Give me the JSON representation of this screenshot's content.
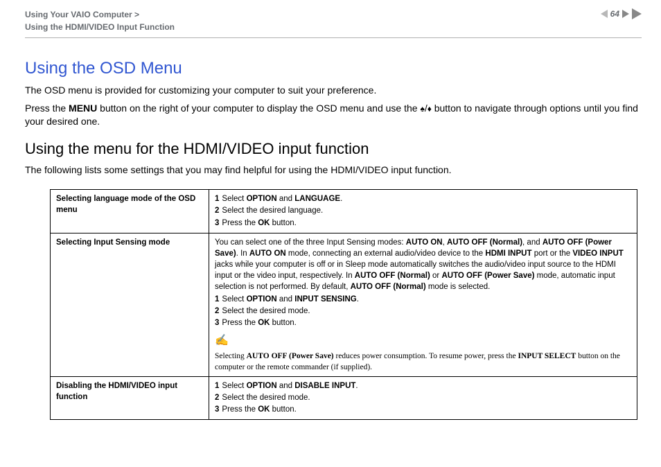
{
  "header": {
    "breadcrumb_line1": "Using Your VAIO Computer >",
    "breadcrumb_line2": "Using the HDMI/VIDEO Input Function",
    "page_number": "64"
  },
  "h1": "Using the OSD Menu",
  "p1_a": "The OSD menu is provided for customizing your computer to suit your preference.",
  "p2_pre": "Press the ",
  "p2_b1": "MENU",
  "p2_mid": " button on the right of your computer to display the OSD menu and use the ",
  "p2_post": " button to navigate through options until you find your desired one.",
  "h2": "Using the menu for the HDMI/VIDEO input function",
  "p3": "The following lists some settings that you may find helpful for using the HDMI/VIDEO input function.",
  "table": {
    "row1": {
      "left": "Selecting language mode of the OSD menu",
      "s1a": "1",
      "s1b": "Select ",
      "s1c": "OPTION",
      "s1d": " and ",
      "s1e": "LANGUAGE",
      "s1f": ".",
      "s2a": "2",
      "s2b": "Select the desired language.",
      "s3a": "3",
      "s3b": "Press the ",
      "s3c": "OK",
      "s3d": " button."
    },
    "row2": {
      "left": "Selecting Input Sensing mode",
      "d_a": "You can select one of the three Input Sensing modes: ",
      "d_b": "AUTO ON",
      "d_c": ", ",
      "d_d": "AUTO OFF (Normal)",
      "d_e": ", and ",
      "d_f": "AUTO OFF (Power Save)",
      "d_g": ". In ",
      "d_h": "AUTO ON",
      "d_i": " mode, connecting an external audio/video device to the ",
      "d_j": "HDMI INPUT",
      "d_k": " port or the ",
      "d_l": "VIDEO INPUT",
      "d_m": " jacks while your computer is off or in Sleep mode automatically switches the audio/video input source to the HDMI input or the video input, respectively. In ",
      "d_n": "AUTO OFF (Normal)",
      "d_o": " or ",
      "d_p": "AUTO OFF (Power Save)",
      "d_q": " mode, automatic input selection is not performed. By default, ",
      "d_r": "AUTO OFF (Normal)",
      "d_s": " mode is selected.",
      "s1a": "1",
      "s1b": "Select ",
      "s1c": "OPTION",
      "s1d": " and ",
      "s1e": "INPUT SENSING",
      "s1f": ".",
      "s2a": "2",
      "s2b": "Select the desired mode.",
      "s3a": "3",
      "s3b": "Press the ",
      "s3c": "OK",
      "s3d": " button.",
      "note_icon": "✍",
      "n_a": "Selecting ",
      "n_b": "AUTO OFF (Power Save)",
      "n_c": " reduces power consumption. To resume power, press the ",
      "n_d": "INPUT SELECT",
      "n_e": " button on the computer or the remote commander (if supplied)."
    },
    "row3": {
      "left": "Disabling the HDMI/VIDEO input function",
      "s1a": "1",
      "s1b": "Select ",
      "s1c": "OPTION",
      "s1d": " and ",
      "s1e": "DISABLE INPUT",
      "s1f": ".",
      "s2a": "2",
      "s2b": "Select the desired mode.",
      "s3a": "3",
      "s3b": "Press the ",
      "s3c": "OK",
      "s3d": " button."
    }
  }
}
